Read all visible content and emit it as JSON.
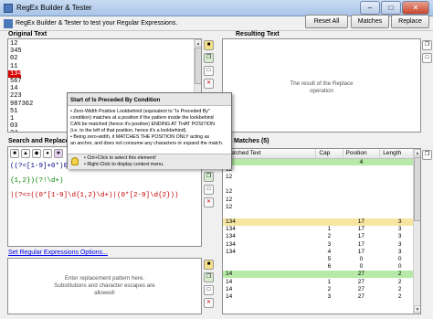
{
  "window": {
    "title": "RegEx Builder & Tester"
  },
  "infobar": {
    "text": "RegEx Builder & Tester to test your Regular Expressions."
  },
  "toolbar": {
    "reset_all": "Reset All",
    "matches": "Matches",
    "replace": "Replace"
  },
  "original": {
    "label": "Original Text",
    "lines": [
      "12",
      "345",
      "02",
      "11",
      "134",
      "567",
      "14",
      "223",
      "987362",
      "51",
      "1",
      "03",
      "34"
    ],
    "highlighted_index": 4
  },
  "resulting": {
    "label": "Resulting Text",
    "placeholder_line1": "The result of the Replace",
    "placeholder_line2": "operation"
  },
  "search": {
    "label": "Search and Replace"
  },
  "tooltip": {
    "title": "Start of Is Preceded By Condition",
    "body_lines": [
      "• Zero-Width Positive Lookbehind (equivalent to \"Is Preceded By\"",
      "condition) matches at a position if the pattern inside the lookbehind",
      "CAN be matched (hence it's positive) ENDING AT THAT POSITION",
      "(i.e. to the left of that position, hence it's a lookbehind).",
      "• Being zero-width, it MATCHES THE POSITION ONLY acting as",
      "an anchor, and does not consume any characters or expand the match."
    ],
    "foot_line1": "• Ctrl+Click to select this element!",
    "foot_line2": "• Right-Click to display context menu."
  },
  "regex": {
    "line1": "((?<[1-9]+0*)0+(?<1[1-9]...",
    "line2": "{1,2})(?!\\d+)",
    "line3": "|(?<=((0*[1-9]\\d{1,2}\\d+)|(0*[2-9]\\d{2}))"
  },
  "options_link": "Set Regular Expressions Options...",
  "replacement": {
    "placeholder_line1": "Enter replacement pattern here.",
    "placeholder_line2": "Substitutions and character escapes are",
    "placeholder_line3": "allowed!"
  },
  "matches": {
    "label": "Matches (5)",
    "columns": [
      "Matched Text",
      "Cap",
      "Position",
      "Length"
    ],
    "rows": [
      {
        "text": "14",
        "cap": "",
        "pos": "4",
        "len": "",
        "grp": "a"
      },
      {
        "text": "12",
        "cap": "",
        "pos": "",
        "len": "",
        "grp": ""
      },
      {
        "text": "12",
        "cap": "",
        "pos": "",
        "len": "",
        "grp": ""
      },
      {
        "text": "",
        "cap": "",
        "pos": "",
        "len": "",
        "grp": ""
      },
      {
        "text": "12",
        "cap": "",
        "pos": "",
        "len": "",
        "grp": ""
      },
      {
        "text": "12",
        "cap": "",
        "pos": "",
        "len": "",
        "grp": ""
      },
      {
        "text": "12",
        "cap": "",
        "pos": "",
        "len": "",
        "grp": ""
      },
      {
        "text": "",
        "cap": "",
        "pos": "",
        "len": "",
        "grp": ""
      },
      {
        "text": "134",
        "cap": "",
        "pos": "17",
        "len": "3",
        "grp": "b"
      },
      {
        "text": "134",
        "cap": "1",
        "pos": "17",
        "len": "3",
        "grp": ""
      },
      {
        "text": "134",
        "cap": "2",
        "pos": "17",
        "len": "3",
        "grp": ""
      },
      {
        "text": "134",
        "cap": "3",
        "pos": "17",
        "len": "3",
        "grp": ""
      },
      {
        "text": "134",
        "cap": "4",
        "pos": "17",
        "len": "3",
        "grp": ""
      },
      {
        "text": "",
        "cap": "5",
        "pos": "0",
        "len": "0",
        "grp": ""
      },
      {
        "text": "",
        "cap": "6",
        "pos": "0",
        "len": "0",
        "grp": ""
      },
      {
        "text": "14",
        "cap": "",
        "pos": "27",
        "len": "2",
        "grp": "a"
      },
      {
        "text": "14",
        "cap": "1",
        "pos": "27",
        "len": "2",
        "grp": ""
      },
      {
        "text": "14",
        "cap": "2",
        "pos": "27",
        "len": "2",
        "grp": ""
      },
      {
        "text": "14",
        "cap": "3",
        "pos": "27",
        "len": "2",
        "grp": ""
      }
    ]
  },
  "colors": {
    "highlight": "#d40000",
    "group_a": "#b6eaa6",
    "group_b": "#f7e6a2"
  }
}
